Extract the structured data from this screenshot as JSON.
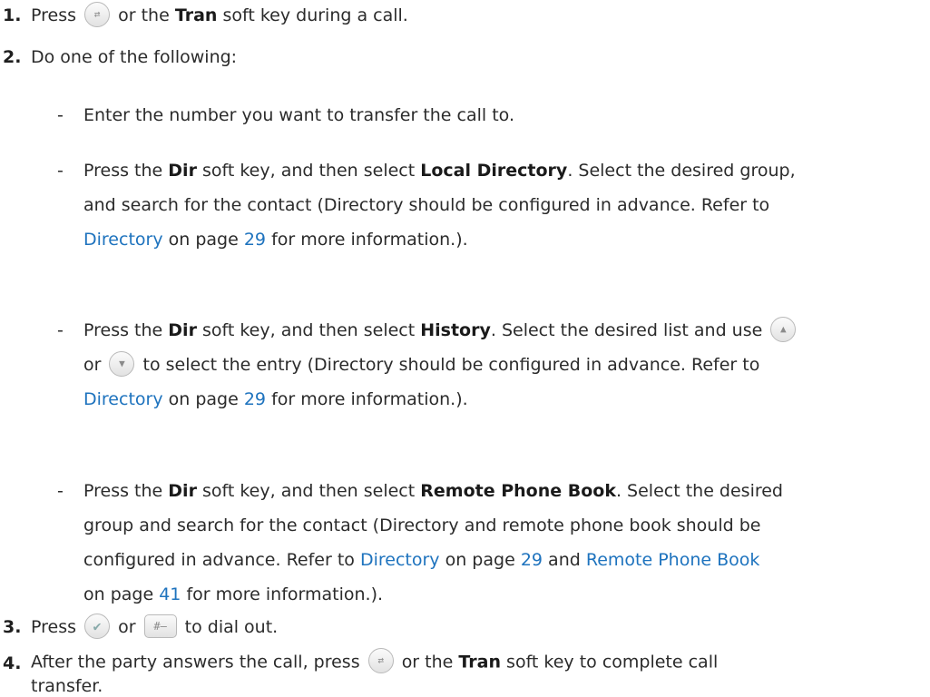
{
  "steps": [
    {
      "num": "1.",
      "before": "Press",
      "key": "transfer-key",
      "after": "or the",
      "softkey": "Tran",
      "rest": "soft key during a call."
    },
    {
      "num": "2.",
      "text": "Do one of the following:"
    },
    {
      "num": "3.",
      "before": "Press",
      "or": "or",
      "after": "to dial out."
    },
    {
      "num": "4.",
      "before": "After the party answers the call, press",
      "after": "or the",
      "softkey": "Tran",
      "rest": "soft key to complete call",
      "line2": "transfer."
    }
  ],
  "options": [
    {
      "dash": "-",
      "l1_a": "Enter the number you want to transfer the call to."
    },
    {
      "dash": "-",
      "l1_a": "Press the",
      "l1_b": "Dir",
      "l1_c": "soft key, and then select",
      "l1_d": "Local Directory",
      "l1_e": ". Select the desired group,",
      "l2": "and search for the contact  (Directory should be configured in advance. Refer to",
      "l3_link": "Directory",
      "l3_a": "on page",
      "l3_page": "29",
      "l3_b": "for more information.)."
    },
    {
      "dash": "-",
      "l1_a": "Press the",
      "l1_b": "Dir",
      "l1_c": "soft key, and then select",
      "l1_d": "History",
      "l1_e": ". Select the desired list and use",
      "l2_a": "or",
      "l2_b": "to select the entry (Directory should be configured in advance. Refer to",
      "l3_link": "Directory",
      "l3_a": "on page",
      "l3_page": "29",
      "l3_b": "for more information.)."
    },
    {
      "dash": "-",
      "l1_a": "Press the",
      "l1_b": "Dir",
      "l1_c": "soft key, and then select",
      "l1_d": "Remote Phone Book",
      "l1_e": ". Select the desired",
      "l2": "group and search for the contact (Directory and remote phone book should be",
      "l3_a": "configured in advance. Refer to",
      "l3_link": "Directory",
      "l3_b": "on page",
      "l3_page": "29",
      "l3_c": "and",
      "l3_link2": "Remote Phone Book",
      "l4_a": "on page",
      "l4_page": "41",
      "l4_b": "for more information.)."
    }
  ],
  "icons": {
    "transfer": "transfer-key-icon",
    "up": "up-arrow-key-icon",
    "down": "down-arrow-key-icon",
    "ok": "ok-check-key-icon",
    "send": "pound-send-key-icon"
  },
  "colors": {
    "link": "#1e73be",
    "text": "#2b2b2b"
  }
}
